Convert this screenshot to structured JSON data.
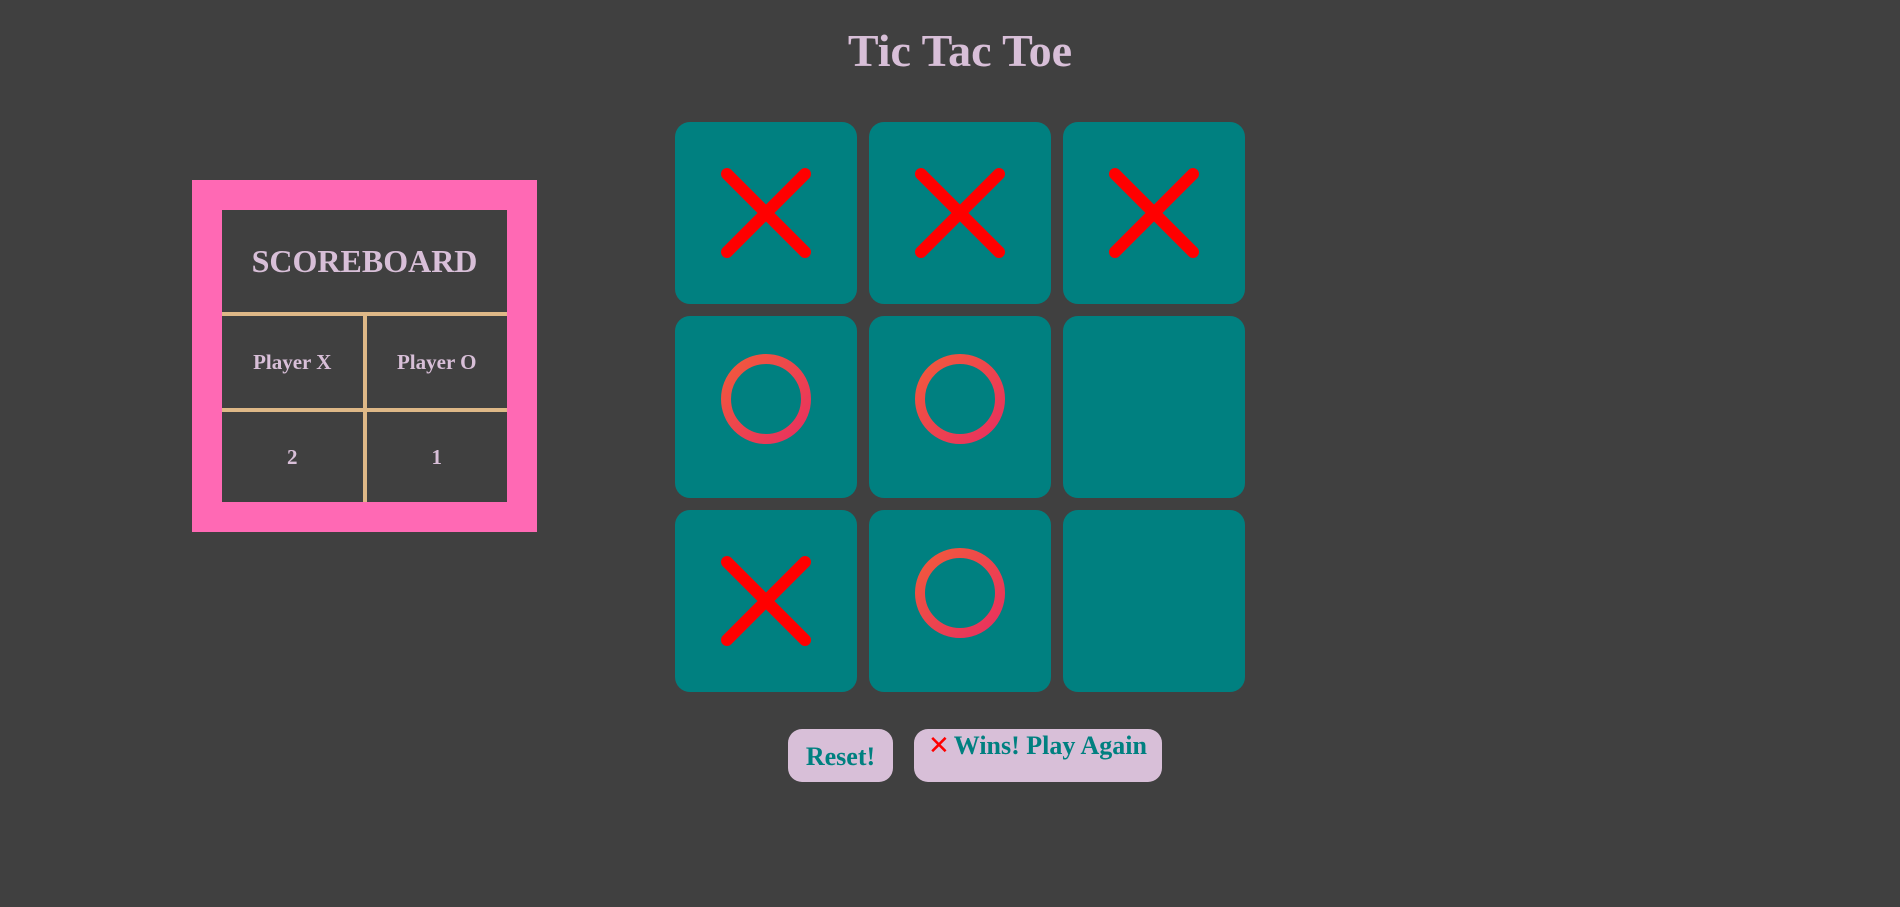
{
  "title": "Tic Tac Toe",
  "scoreboard": {
    "heading": "SCOREBOARD",
    "player_x_label": "Player X",
    "player_o_label": "Player O",
    "player_x_score": "2",
    "player_o_score": "1"
  },
  "board": [
    "X",
    "X",
    "X",
    "O",
    "O",
    "",
    "X",
    "O",
    ""
  ],
  "buttons": {
    "reset": "Reset!",
    "winner_mark": "✕",
    "play_again": "Wins! Play Again"
  },
  "colors": {
    "background": "#404040",
    "cell": "#008080",
    "x_mark": "#ff0000",
    "o_start": "#f25a3c",
    "o_end": "#e8305f",
    "scoreboard_border": "#ff69b4",
    "divider": "#deb887",
    "text": "#d8bfd8"
  }
}
